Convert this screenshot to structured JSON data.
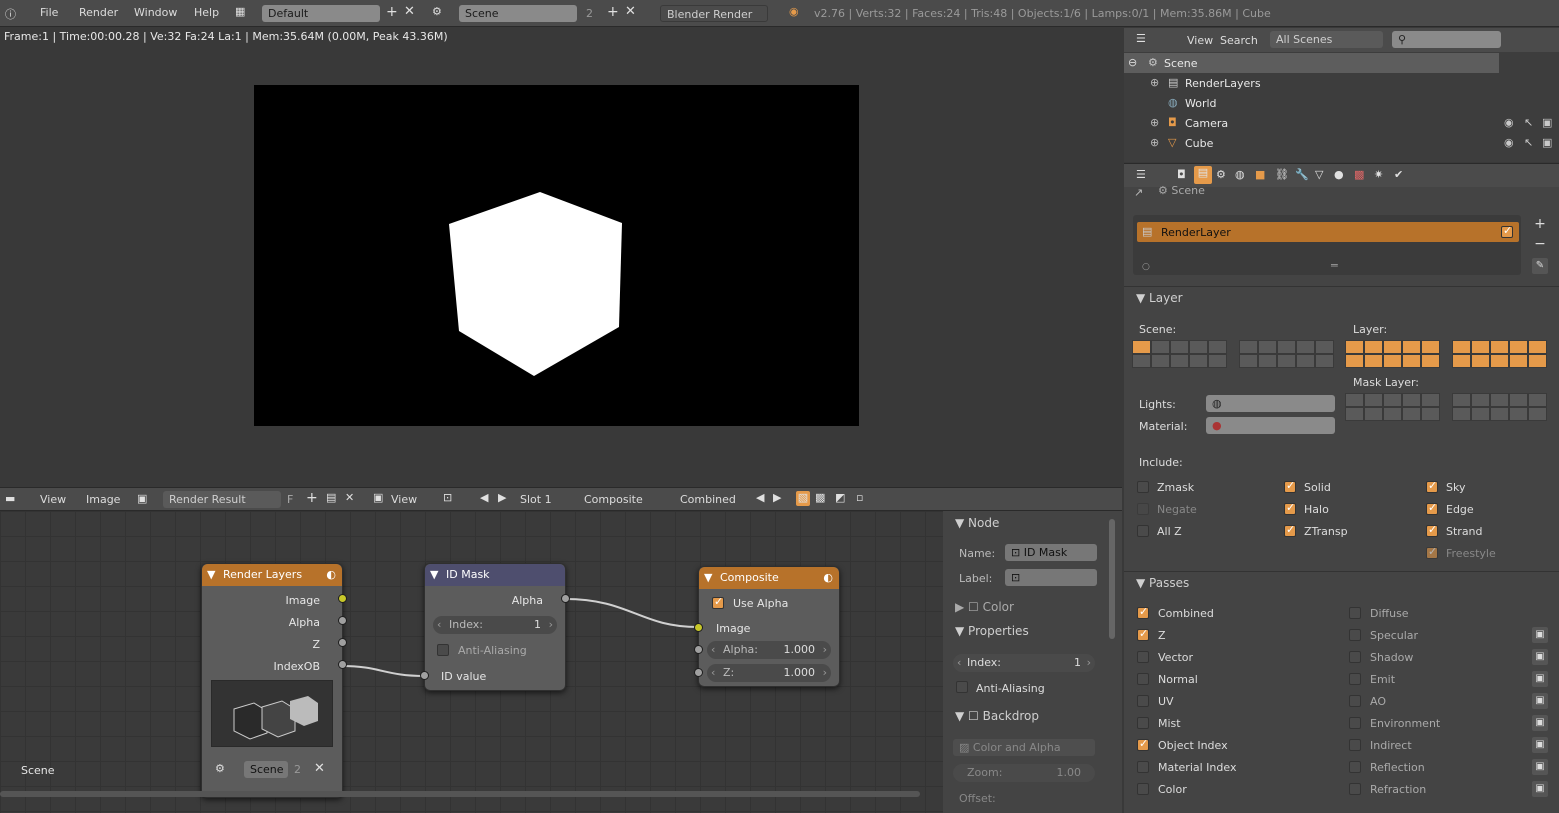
{
  "topbar": {
    "menus": [
      "File",
      "Render",
      "Window",
      "Help"
    ],
    "layout": "Default",
    "scene": "Scene",
    "scene_users": "2",
    "engine": "Blender Render",
    "stats": "v2.76 | Verts:32 | Faces:24 | Tris:48 | Objects:1/6 | Lamps:0/1 | Mem:35.86M | Cube"
  },
  "image_editor": {
    "info": "Frame:1 | Time:00:00.28 | Ve:32 Fa:24 La:1 | Mem:35.64M (0.00M, Peak 43.36M)",
    "header": {
      "view": "View",
      "image": "Image",
      "image_name": "Render Result",
      "fake": "F",
      "view2": "View",
      "slot": "Slot 1",
      "layer": "Composite",
      "pass": "Combined"
    }
  },
  "nodes": {
    "render_layers": {
      "title": "Render Layers",
      "outputs": [
        "Image",
        "Alpha",
        "Z",
        "IndexOB"
      ],
      "scene": "Scene",
      "scene_users": "2"
    },
    "id_mask": {
      "title": "ID Mask",
      "output": "Alpha",
      "index_label": "Index:",
      "index_value": "1",
      "antialias": "Anti-Aliasing",
      "input": "ID value"
    },
    "composite": {
      "title": "Composite",
      "use_alpha": "Use Alpha",
      "image": "Image",
      "alpha_label": "Alpha:",
      "alpha_value": "1.000",
      "z_label": "Z:",
      "z_value": "1.000"
    },
    "bottom_label": "Scene"
  },
  "node_panel": {
    "node_title": "Node",
    "name_label": "Name:",
    "name_value": "ID Mask",
    "label_label": "Label:",
    "color": "Color",
    "properties": "Properties",
    "index_label": "Index:",
    "index_value": "1",
    "antialias": "Anti-Aliasing",
    "backdrop": "Backdrop",
    "color_alpha": "Color and Alpha",
    "zoom_label": "Zoom:",
    "zoom_value": "1.00",
    "offset": "Offset:"
  },
  "outliner": {
    "view": "View",
    "search": "Search",
    "scenes": "All Scenes",
    "items": [
      {
        "label": "Scene"
      },
      {
        "label": "RenderLayers"
      },
      {
        "label": "World"
      },
      {
        "label": "Camera"
      },
      {
        "label": "Cube"
      }
    ]
  },
  "properties": {
    "breadcrumb": "Scene",
    "render_layer": "RenderLayer",
    "layer_title": "Layer",
    "scene_label": "Scene:",
    "layer_label": "Layer:",
    "mask_layer": "Mask Layer:",
    "lights": "Lights:",
    "material": "Material:",
    "include": "Include:",
    "include_items": [
      {
        "label": "Zmask",
        "on": false
      },
      {
        "label": "Solid",
        "on": true
      },
      {
        "label": "Sky",
        "on": true
      },
      {
        "label": "Negate",
        "on": false
      },
      {
        "label": "Halo",
        "on": true
      },
      {
        "label": "Edge",
        "on": true
      },
      {
        "label": "All Z",
        "on": false
      },
      {
        "label": "ZTransp",
        "on": true
      },
      {
        "label": "Strand",
        "on": true
      },
      {
        "label": "",
        "on": false
      },
      {
        "label": "",
        "on": false
      },
      {
        "label": "Freestyle",
        "on": true
      }
    ],
    "passes_title": "Passes",
    "passes_left": [
      {
        "label": "Combined",
        "on": true
      },
      {
        "label": "Z",
        "on": true
      },
      {
        "label": "Vector",
        "on": false
      },
      {
        "label": "Normal",
        "on": false
      },
      {
        "label": "UV",
        "on": false
      },
      {
        "label": "Mist",
        "on": false
      },
      {
        "label": "Object Index",
        "on": true
      },
      {
        "label": "Material Index",
        "on": false
      },
      {
        "label": "Color",
        "on": false
      }
    ],
    "passes_right": [
      {
        "label": "Diffuse",
        "on": false
      },
      {
        "label": "Specular",
        "on": false
      },
      {
        "label": "Shadow",
        "on": false
      },
      {
        "label": "Emit",
        "on": false
      },
      {
        "label": "AO",
        "on": false
      },
      {
        "label": "Environment",
        "on": false
      },
      {
        "label": "Indirect",
        "on": false
      },
      {
        "label": "Reflection",
        "on": false
      },
      {
        "label": "Refraction",
        "on": false
      }
    ]
  },
  "colors": {
    "accent": "#e59a4a",
    "node_header_orange": "#b7722a",
    "id_mask_header": "#4e4e6e"
  }
}
